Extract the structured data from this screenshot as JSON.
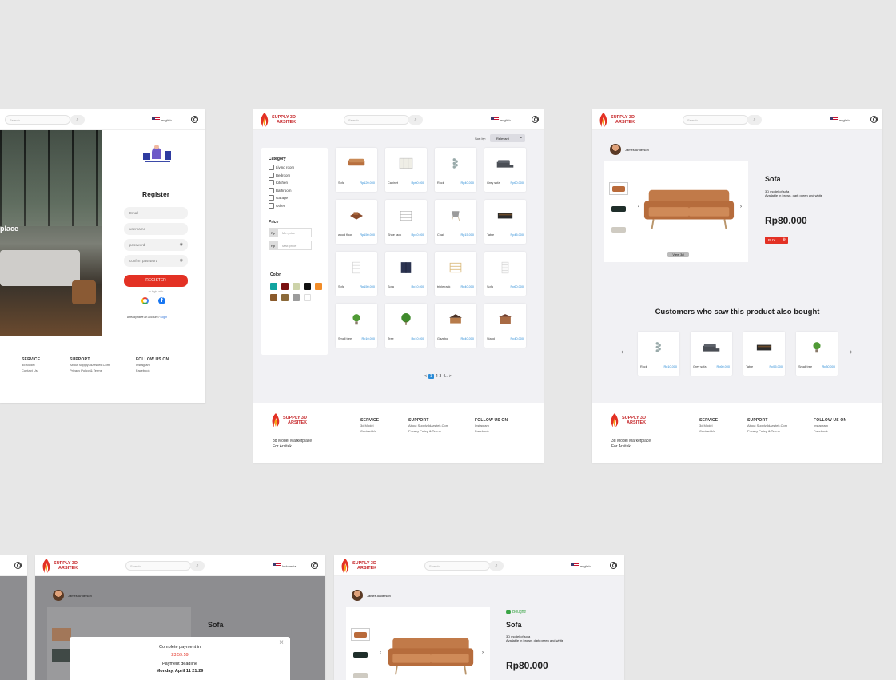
{
  "brand": {
    "line1": "SUPPLY 3D",
    "line2": "ARSITEK",
    "tagline1": "3d Model Marketplace",
    "tagline2": "For Arsitek"
  },
  "header": {
    "search_placeholder": "Search",
    "language": "english",
    "language_id": "Indonesia"
  },
  "footer": {
    "service": "SERVICE",
    "service_items": [
      "3d Model",
      "Contact Us"
    ],
    "support": "SUPPORT",
    "support_items": [
      "About Supply3dArsitek.Com",
      "Privacy Policy & Terms"
    ],
    "follow": "FOLLOW US ON",
    "follow_items": [
      "Instagram",
      "Facebook"
    ]
  },
  "register": {
    "hero_text": "place",
    "title": "Register",
    "fields": [
      "Email",
      "username",
      "password",
      "confirm password"
    ],
    "button": "REGISTER",
    "or": "or login with",
    "have_account": "Already have an account?",
    "login": "Login"
  },
  "catalog": {
    "sort_label": "Sort by:",
    "sort_value": "Relevant",
    "category_title": "Category",
    "categories": [
      "Living room",
      "Bedroom",
      "Kitchen",
      "Bathroom",
      "Garage",
      "Other"
    ],
    "price_title": "Price",
    "price_prefix": "Rp",
    "min_placeholder": "Min price",
    "max_placeholder": "Max price",
    "color_title": "Color",
    "colors": [
      "#11a4a0",
      "#7a1010",
      "#cdd3a9",
      "#111111",
      "#f28c28",
      "#8a5a2b",
      "#8b6a3a",
      "#9c9c9c",
      "#ffffff"
    ],
    "products": [
      {
        "name": "Sofa",
        "price": "Rp120.000",
        "icon": "sofa-icon"
      },
      {
        "name": "Cabinet",
        "price": "Rp60.000",
        "icon": "cabinet-icon"
      },
      {
        "name": "Rock",
        "price": "Rp40.000",
        "icon": "rock-icon"
      },
      {
        "name": "Grey sofa",
        "price": "Rp60.000",
        "icon": "grey-sofa-icon"
      },
      {
        "name": "wood floor",
        "price": "Rp150.000",
        "icon": "wood-floor-icon"
      },
      {
        "name": "Shoe rack",
        "price": "Rp40.000",
        "icon": "shoe-rack-icon"
      },
      {
        "name": "Chair",
        "price": "Rp15.000",
        "icon": "chair-icon"
      },
      {
        "name": "Table",
        "price": "Rp45.000",
        "icon": "table-icon"
      },
      {
        "name": "Sofa",
        "price": "Rp150.000",
        "icon": "shelf-icon"
      },
      {
        "name": "Sofa",
        "price": "Rp10.000",
        "icon": "wardrobe-icon"
      },
      {
        "name": "triple rack",
        "price": "Rp40.000",
        "icon": "triple-rack-icon"
      },
      {
        "name": "Sofa",
        "price": "Rp60.000",
        "icon": "bookcase-icon"
      },
      {
        "name": "Small tree",
        "price": "Rp10.000",
        "icon": "small-tree-icon"
      },
      {
        "name": "Tree",
        "price": "Rp10.000",
        "icon": "tree-icon"
      },
      {
        "name": "Gazebo",
        "price": "Rp40.000",
        "icon": "gazebo-icon"
      },
      {
        "name": "Stand",
        "price": "Rp40.000",
        "icon": "stand-icon"
      }
    ],
    "pagination": [
      "<",
      "1",
      "2",
      "3",
      "4..",
      ">"
    ]
  },
  "product": {
    "seller": "James Anderson",
    "title": "Sofa",
    "desc1": "3D model of sofa",
    "desc2": "Available in brown, dark green and white",
    "price": "Rp80.000",
    "buy": "BUY",
    "view3d": "View 3d",
    "also_title": "Customers who saw this product also bought",
    "also": [
      {
        "name": "Rock",
        "price": "Rp10.000"
      },
      {
        "name": "Grey sofa",
        "price": "Rp60.000"
      },
      {
        "name": "Table",
        "price": "Rp55.000"
      },
      {
        "name": "Small tree",
        "price": "Rp30.000"
      }
    ]
  },
  "payment": {
    "title": "Complete payment in",
    "timer": "23:59:59",
    "deadline_label": "Payment deadline",
    "deadline": "Monday, April 11 21:29"
  },
  "bought": {
    "badge": "Bought!",
    "title": "Sofa",
    "desc1": "3D model of sofa",
    "desc2": "Available in brown, dark green and white",
    "price": "Rp80.000"
  }
}
